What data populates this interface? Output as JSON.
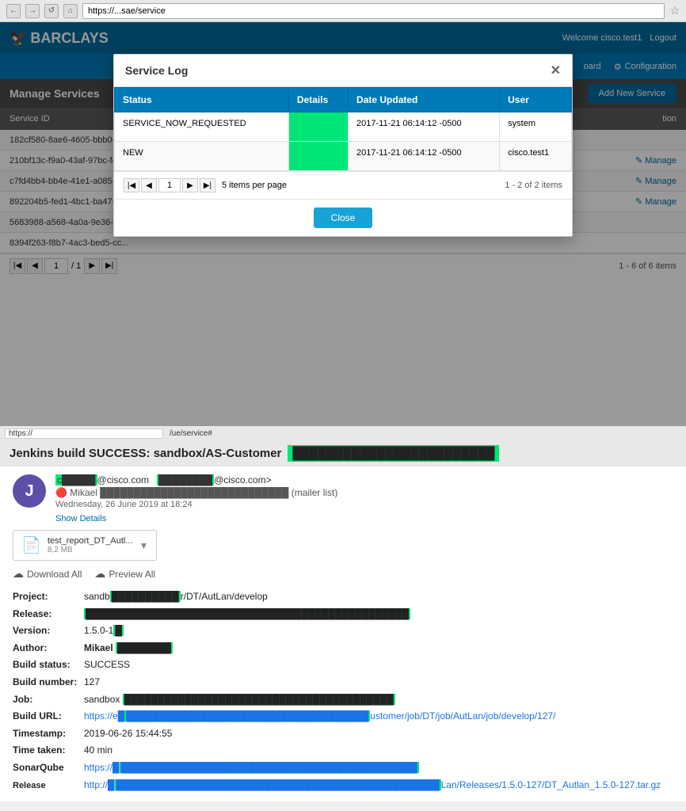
{
  "browser": {
    "url": "https://...sae/service",
    "back_btn": "←",
    "forward_btn": "→",
    "refresh_btn": "↺",
    "home_btn": "⌂",
    "star": "☆"
  },
  "barclays": {
    "logo_text": "BARCLAYS",
    "header_right": {
      "welcome": "Welcome cisco.test1",
      "logout": "Logout"
    },
    "sub_header": {
      "dashboard": "oard",
      "configuration": "Configuration"
    },
    "manage_services": {
      "title": "Manage Services",
      "add_btn": "Add New Service"
    },
    "table": {
      "headers": [
        "Service ID",
        "",
        "",
        "tion"
      ],
      "rows": [
        {
          "id": "182cf580-8ae6-4605-bbb0-8a...",
          "action": ""
        },
        {
          "id": "210bf13c-f9a0-43af-97bc-f4...",
          "action": "✎ Manage"
        },
        {
          "id": "c7fd4bb4-bb4e-41e1-a085-9d...",
          "action": "✎ Manage"
        },
        {
          "id": "892204b5-fed1-4bc1-ba47-3...",
          "action": "✎ Manage"
        },
        {
          "id": "5683988-a568-4a0a-9e36-52...",
          "action": ""
        },
        {
          "id": "8394f263-f8b7-4ac3-bed5-cc...",
          "action": ""
        }
      ]
    },
    "pagination": {
      "page_label": "1",
      "total_label": "/ 1",
      "items_info": "1 - 6 of 6 items"
    }
  },
  "modal": {
    "title": "Service Log",
    "close_x": "✕",
    "table": {
      "headers": [
        "Status",
        "Details",
        "Date Updated",
        "User"
      ],
      "rows": [
        {
          "status": "SERVICE_NOW_REQUESTED",
          "details_green": true,
          "date": "2017-11-21 06:14:12 -0500",
          "user": "system"
        },
        {
          "status": "NEW",
          "details_green": true,
          "date": "2017-11-21 06:14:12 -0500",
          "user": "cisco.test1"
        }
      ]
    },
    "pagination": {
      "items_per_page": "5 items per page",
      "range_info": "1 - 2 of 2 items",
      "page_value": "1"
    },
    "close_btn": "Close"
  },
  "status_bar": {
    "left_url": "https://",
    "right_url": "/ue/service#"
  },
  "jenkins": {
    "title_prefix": "Jenkins build SUCCESS: sandbox/AS-Customer",
    "title_redact": "████████████████████████"
  },
  "email": {
    "avatar_letter": "J",
    "from_redact": "c█████",
    "from_domain": "@cisco.com",
    "to_redact": "████████",
    "to_domain": "@cisco.com>",
    "mikael_line": "Mikael ████████████████████████████ (mailer list)",
    "date": "Wednesday, 26 June 2019 at 18:24",
    "show_details": "Show Details",
    "attachment": {
      "name": "test_report_DT_Autl...",
      "size": "8,2 MB",
      "dropdown": "▼"
    },
    "download_all": "Download All",
    "preview_all": "Preview All"
  },
  "build_info": {
    "project_label": "Project:",
    "project_value": "sandb",
    "project_redact": "██████████",
    "project_suffix": "r/DT/AutLan/develop",
    "release_label": "Release:",
    "release_redact": "████████████████████████████████████████████████",
    "version_label": "Version:",
    "version_value": "1.5.0-1",
    "version_redact": "█",
    "author_label": "Author:",
    "author_value": "Mikael",
    "author_redact": "████████",
    "build_status_label": "Build status:",
    "build_status_value": "SUCCESS",
    "build_number_label": "Build number:",
    "build_number_value": "127",
    "job_label": "Job:",
    "job_value": "sandbox",
    "job_redact": "████████████████████████████████████████",
    "build_url_label": "Build URL:",
    "build_url_prefix": "https://e█",
    "build_url_redact": "████████████████████████████████████",
    "build_url_suffix": "ustomer/job/DT/job/AutLan/job/develop/127/",
    "timestamp_label": "Timestamp:",
    "timestamp_value": "2019-06-26 15:44:55",
    "time_taken_label": "Time taken:",
    "time_taken_value": "40 min",
    "sonarqube_label": "SonarQube",
    "sonarqube_url": "https://█",
    "sonarqube_redact": "████████████████████████████████████████████",
    "release_label2": "Release",
    "release_url": "http://█",
    "release_url_suffix": "Lan/Releases/1.5.0-127/DT_Autlan_1.5.0-127.tar.gz"
  }
}
